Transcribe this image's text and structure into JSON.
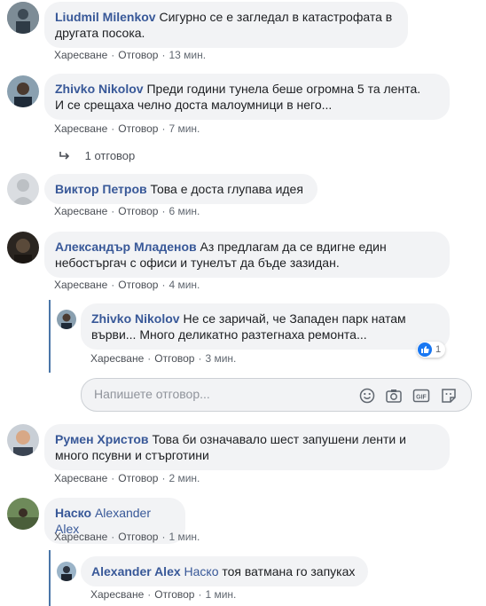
{
  "actions": {
    "like": "Харесване",
    "reply": "Отговор"
  },
  "comments": [
    {
      "author": "Liudmil Milenkov",
      "lines": [
        "Сигурно се е загледал в катастрофата в",
        "другата посока."
      ],
      "time": "13 мин."
    },
    {
      "author": "Zhivko Nikolov",
      "lines": [
        "Преди години тунела беше огромна 5 та лента.",
        "И се срещаха челно доста малоумници в него..."
      ],
      "time": "7 мин.",
      "replies_link": "1 отговор"
    },
    {
      "author": "Виктор Петров",
      "lines": [
        "Това е доста глупава идея"
      ],
      "time": "6 мин."
    },
    {
      "author": "Александър Младенов",
      "lines": [
        "Аз предлагам да се вдигне един",
        "небостъргач с офиси и тунелът да бъде зазидан."
      ],
      "time": "4 мин.",
      "reply": {
        "author": "Zhivko Nikolov",
        "lines": [
          "Не се заричай, че Западен парк натам",
          "върви... Много деликатно разтегнаха ремонта..."
        ],
        "time": "3 мин.",
        "reaction_count": "1"
      }
    },
    {
      "author": "Румен Христов",
      "lines": [
        "Това би означавало шест запушени ленти и",
        "много псувни и стърготини"
      ],
      "time": "2 мин."
    },
    {
      "author": "Наско",
      "tagged": "Alexander Alex",
      "lines": [
        ""
      ],
      "time": "1 мин.",
      "reply": {
        "author": "Alexander Alex",
        "tagged": "Наско",
        "text": "тоя ватмана го запуках",
        "time": "1 мин."
      }
    }
  ],
  "reply_input": {
    "placeholder": "Напишете отговор..."
  },
  "icons": [
    "emoji-icon",
    "camera-icon",
    "gif-icon",
    "sticker-icon",
    "reply-arrow-icon",
    "like-reaction-icon"
  ],
  "colors": {
    "author": "#385898",
    "bubble": "#f2f3f5",
    "thread_line": "#4a76a8",
    "like": "#1877f2"
  }
}
